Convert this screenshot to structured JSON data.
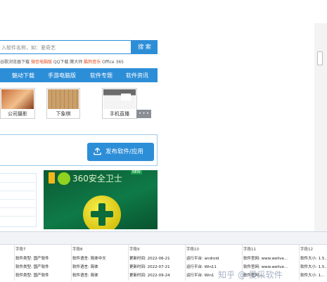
{
  "search": {
    "placeholder": "入软件名称，如：爱奇艺",
    "button_label": "搜 索",
    "hot_prefix": "谷歌浏览器下载",
    "hot_red_1": "微信电脑版",
    "hot_mid": "QQ下载 腾大师",
    "hot_red_2": "酷狗音乐",
    "hot_end": "Office 365"
  },
  "nav": {
    "items": [
      "魅动下载",
      "手游电脑版",
      "软件专题",
      "软件资讯"
    ]
  },
  "thumbnails": [
    {
      "caption": "公司摄影"
    },
    {
      "caption": "下象棋"
    },
    {
      "caption": "手机直播",
      "overlay": "• • •"
    }
  ],
  "publish": {
    "label": "发布软件/应用",
    "icon": "upload-icon"
  },
  "ad": {
    "brand": "360安全卫士",
    "badge": "NEW"
  },
  "table": {
    "headers": [
      "字段7",
      "字段8",
      "字段9",
      "字段10",
      "字段11",
      "字段12"
    ],
    "rows": [
      [
        "软件类型: 国产软件",
        "软件语言: 简体中文",
        "更新时间: 2022-06-21",
        "运行平台: android",
        "软件官网: www.welive...",
        "软件大小: 1.5..."
      ],
      [
        "软件类型: 国产软件",
        "软件语言: 简体",
        "更新时间: 2022-07-21",
        "运行平台: Win11",
        "软件官网: www.welive...",
        "软件大小: 1.5..."
      ],
      [
        "软件类型: 国产软件",
        "软件语言: 简体",
        "更新时间: 2022-09-24",
        "运行平台: Win1",
        "软件官网: ...",
        "软件大小: 1..."
      ]
    ]
  },
  "watermark": "知乎 @ 爱采软件"
}
